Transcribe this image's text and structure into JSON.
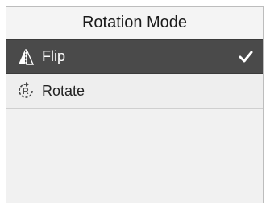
{
  "header": {
    "title": "Rotation Mode"
  },
  "menu": {
    "items": [
      {
        "label": "Flip",
        "icon": "flip-icon",
        "selected": true
      },
      {
        "label": "Rotate",
        "icon": "rotate-icon",
        "selected": false
      }
    ]
  },
  "colors": {
    "selected_bg": "#4a4a4a",
    "selected_text": "#ffffff",
    "normal_bg": "#eeeeee",
    "header_bg": "#f4f4f4"
  },
  "check_icon": "checkmark-icon"
}
